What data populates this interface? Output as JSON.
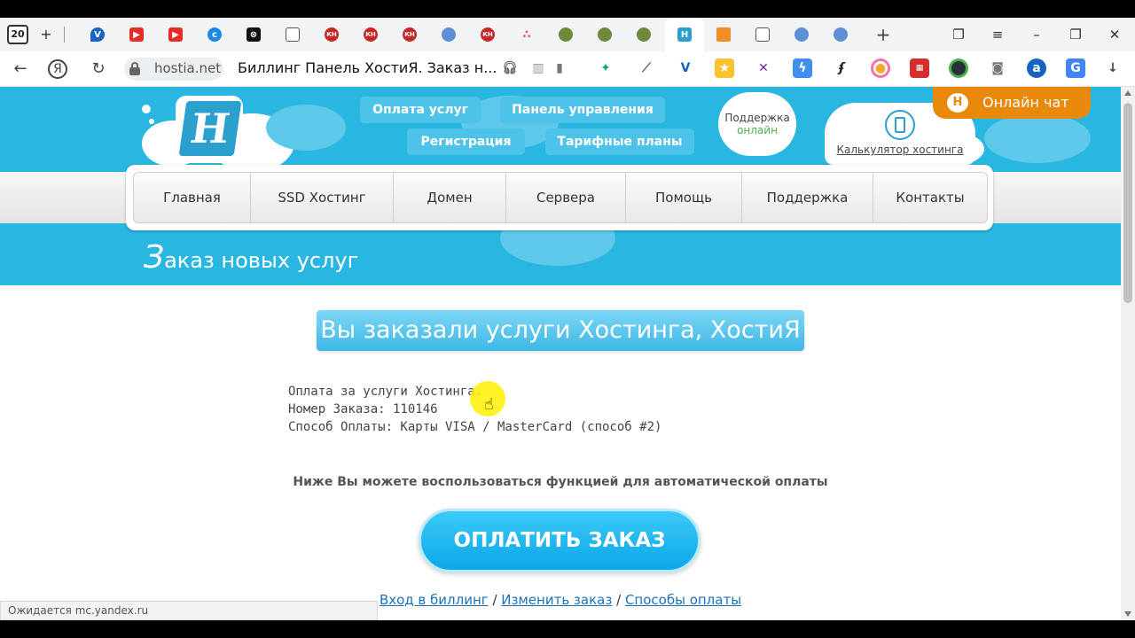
{
  "browser": {
    "tab_count": "20",
    "address": {
      "domain": "hostia.net"
    },
    "page_title": "Биллинг Панель ХостиЯ. Заказ н...",
    "status": "Ожидается mc.yandex.ru"
  },
  "site": {
    "logo_letter": "H",
    "top_links": [
      "Оплата услуг",
      "Панель управления",
      "Регистрация",
      "Тарифные планы"
    ],
    "support": {
      "label": "Поддержка",
      "state": "онлайн"
    },
    "calculator_link": "Калькулятор хостинга",
    "chat_label": "Онлайн чат",
    "chat_icon_letter": "H",
    "menu": [
      "Главная",
      "SSD Хостинг",
      "Домен",
      "Сервера",
      "Помощь",
      "Поддержка",
      "Контакты"
    ],
    "heading_first": "З",
    "heading_rest": "аказ новых услуг"
  },
  "order": {
    "banner": "Вы заказали услуги Хостинга, ХостиЯ !",
    "line1": "Оплата за услуги Хостинга.",
    "line2": "Номер Заказа: 110146",
    "line3": "Способ Оплаты: Карты VISA / MasterCard (способ #2)",
    "auto_pay_note": "Ниже Вы можете воспользоваться функцией для автоматической оплаты",
    "pay_button": "ОПЛАТИТЬ ЗАКАЗ",
    "links": {
      "billing": "Вход в биллинг",
      "sep": "/",
      "change": "Изменить заказ",
      "methods": "Способы оплаты"
    }
  },
  "colors": {
    "brand_blue": "#29b6e0",
    "chat_orange": "#e8890c",
    "pay_button": "#0aa7e8"
  }
}
